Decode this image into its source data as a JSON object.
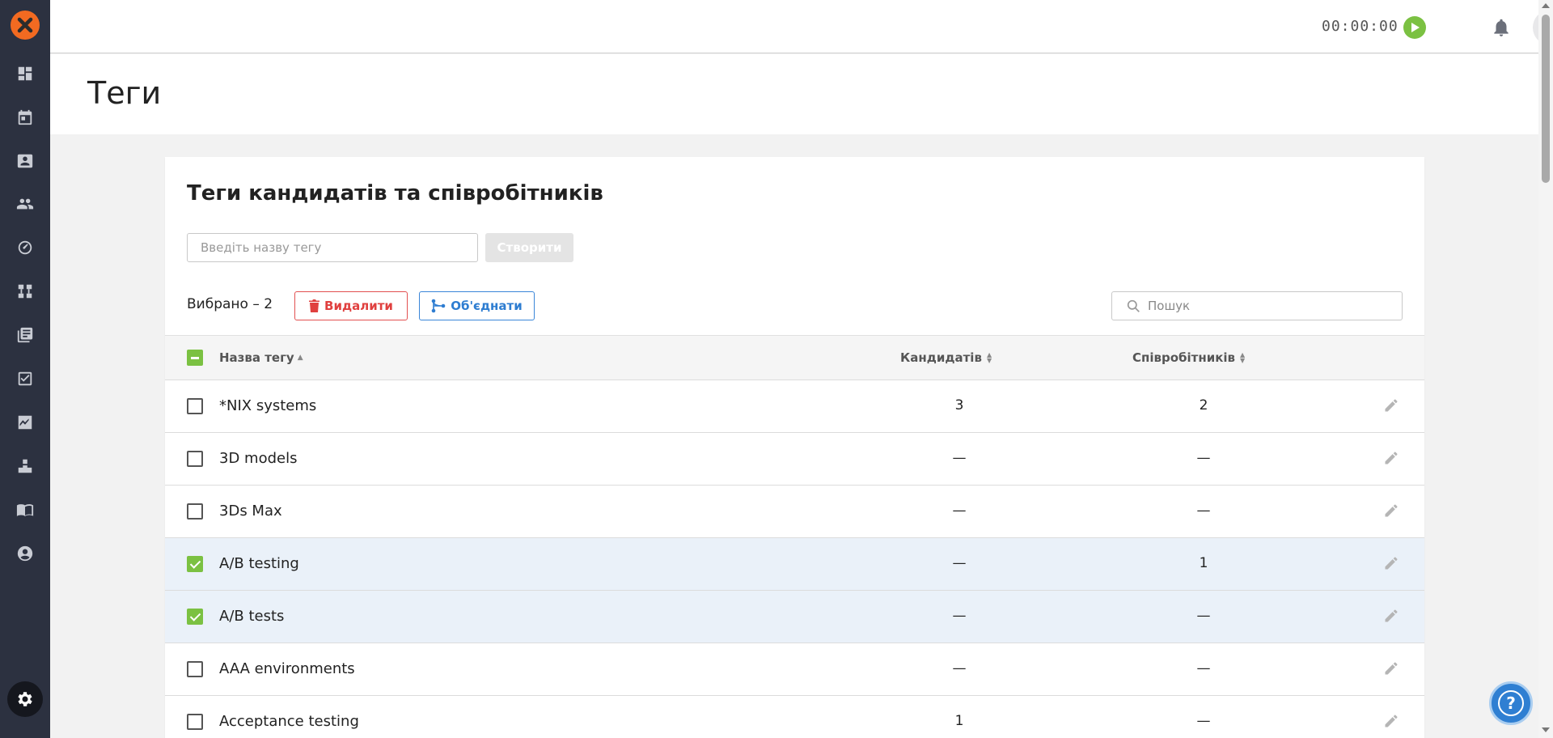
{
  "sidebar": {
    "items": [
      {
        "icon": "dashboard-icon"
      },
      {
        "icon": "calendar-icon"
      },
      {
        "icon": "contacts-icon"
      },
      {
        "icon": "people-icon"
      },
      {
        "icon": "speedometer-icon"
      },
      {
        "icon": "workflow-icon"
      },
      {
        "icon": "library-icon"
      },
      {
        "icon": "tasks-check-icon"
      },
      {
        "icon": "analytics-icon"
      },
      {
        "icon": "boxes-icon"
      },
      {
        "icon": "book-icon"
      },
      {
        "icon": "account-circle-icon"
      }
    ],
    "settings_icon": "gear-icon"
  },
  "topbar": {
    "timer": "00:00:00"
  },
  "page": {
    "title": "Теги"
  },
  "card": {
    "title": "Теги кандидатів та співробітників",
    "tag_input_placeholder": "Введіть назву тегу",
    "create_label": "Створити",
    "selected_count": "Вибрано – 2",
    "delete_label": "Видалити",
    "merge_label": "Об'єднати",
    "search_placeholder": "Пошук"
  },
  "table": {
    "columns": {
      "name": "Назва тегу",
      "candidates": "Кандидатів",
      "employees": "Співробітників"
    },
    "header_checkbox": "partial",
    "rows": [
      {
        "name": "*NIX systems",
        "candidates": "3",
        "employees": "2",
        "checked": false
      },
      {
        "name": "3D models",
        "candidates": "—",
        "employees": "—",
        "checked": false
      },
      {
        "name": "3Ds Max",
        "candidates": "—",
        "employees": "—",
        "checked": false
      },
      {
        "name": "A/B testing",
        "candidates": "—",
        "employees": "1",
        "checked": true
      },
      {
        "name": "A/B tests",
        "candidates": "—",
        "employees": "—",
        "checked": true
      },
      {
        "name": "AAA environments",
        "candidates": "—",
        "employees": "—",
        "checked": false
      },
      {
        "name": "Acceptance testing",
        "candidates": "1",
        "employees": "—",
        "checked": false
      }
    ]
  },
  "help": {
    "label": "?"
  },
  "colors": {
    "sidebar": "#2c3140",
    "brand": "#f26a21",
    "accent_green": "#7bc142",
    "danger": "#e0403f",
    "primary": "#2e7dd1"
  }
}
